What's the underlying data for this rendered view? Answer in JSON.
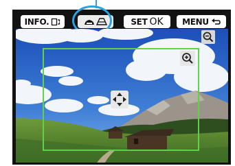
{
  "toolbar": {
    "info_label": "INFO.",
    "info_icon": "trim-rotate-icon",
    "filter_icon": "miniature-filter-icon",
    "set_label": "SET",
    "ok_label": "OK",
    "menu_label": "MENU",
    "menu_icon": "return-arrow-icon"
  },
  "preview": {
    "zoom_out_icon": "zoom-out-icon",
    "zoom_in_icon": "zoom-in-icon",
    "move_icon": "move-frame-icon",
    "frame_color": "#5fd24a"
  },
  "colors": {
    "highlight": "#2aa3e0",
    "button_bg": "#ffffff",
    "screen_bg": "#121212"
  }
}
